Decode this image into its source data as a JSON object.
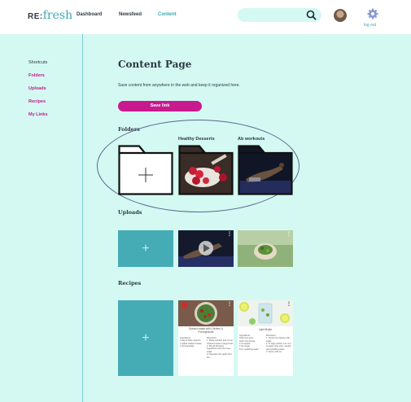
{
  "header": {
    "logo_prefix": "RE:",
    "logo_word": "fresh",
    "nav": [
      "Dashboard",
      "Newsfeed",
      "Content"
    ],
    "active_nav": "Content",
    "search_placeholder": "",
    "logout_label": "log out",
    "icons": {
      "search": "search-icon",
      "settings": "gear-icon",
      "avatar": "user-avatar"
    }
  },
  "sidebar": {
    "heading": "Shortcuts",
    "items": [
      "Folders",
      "Uploads",
      "Recipes",
      "My Links"
    ]
  },
  "main": {
    "title": "Content Page",
    "subtitle": "Save content from anywhere in the web and keep it organized here.",
    "save_button": "Save link",
    "sections": {
      "folders": {
        "label": "Folders",
        "items": [
          {
            "label": "",
            "kind": "add"
          },
          {
            "label": "Healthy Desserts",
            "kind": "folder-image"
          },
          {
            "label": "Ab workouts",
            "kind": "folder-image"
          }
        ]
      },
      "uploads": {
        "label": "Uploads",
        "items": [
          {
            "kind": "add"
          },
          {
            "kind": "video"
          },
          {
            "kind": "image"
          }
        ]
      },
      "recipes": {
        "label": "Recipes",
        "items": [
          {
            "kind": "add"
          },
          {
            "kind": "recipe",
            "title": "Spinach salad with Chicken & Pomegranate",
            "col1": "Ingredients:\n1 bag of baby spinach\n1 grilled chicken breast\n1 pomegranate",
            "col2": "Directions:\n1. Place spinach and cut-up chicken breast in large bowl\n2. Mix all dressing ingredients and pour over salad\n3. Seperate the seeds from the..."
          },
          {
            "kind": "recipe",
            "title": "Light Mojito",
            "col1": "Ingredients:\nfresh lime juice\nfresh mint leaves\n2 oz tequila\n2 tsp sugar\n8 oz. sparkling water",
            "col2": "Directions:\n1. Crush mint leaves with sugar.\n2. In large pitcher mix mint & sugar, lime juice, tequila and sparkling water.\n3. Serve with ice."
          }
        ]
      }
    }
  },
  "colors": {
    "background": "#d3f9f2",
    "accent": "#c8198f",
    "teal": "#3aa9b4",
    "tile": "#45acb6"
  }
}
